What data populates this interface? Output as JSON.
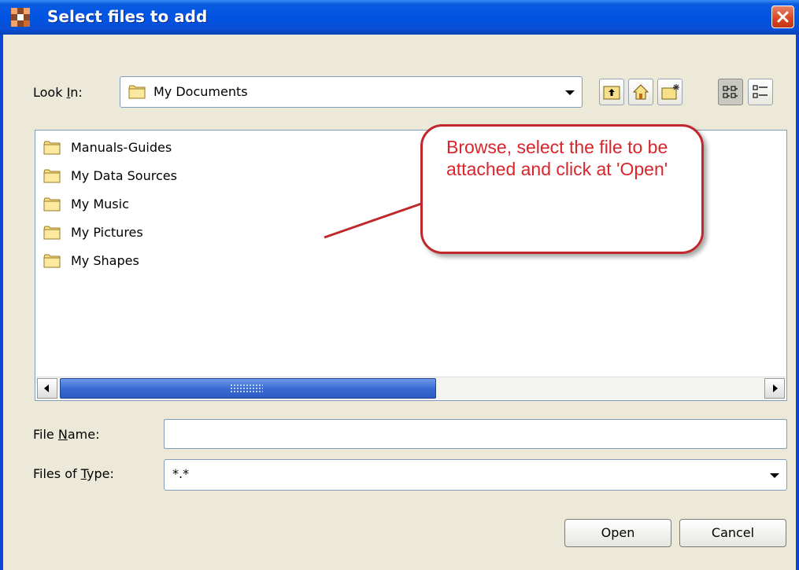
{
  "window": {
    "title": "Select files to add"
  },
  "look_in": {
    "label_pre": "Look ",
    "label_mnemonic": "I",
    "label_post": "n:",
    "value": "My Documents"
  },
  "files": [
    {
      "name": "Manuals-Guides"
    },
    {
      "name": "My Data Sources"
    },
    {
      "name": "My Music"
    },
    {
      "name": "My Pictures"
    },
    {
      "name": "My Shapes"
    }
  ],
  "file_name": {
    "label_pre": "File ",
    "label_mnemonic": "N",
    "label_post": "ame:",
    "value": ""
  },
  "file_type": {
    "label_pre": "Files of ",
    "label_mnemonic": "T",
    "label_post": "ype:",
    "value": "*.*"
  },
  "buttons": {
    "open": "Open",
    "cancel": "Cancel"
  },
  "callout": {
    "text": "Browse, select the file to be attached and click at 'Open'"
  },
  "icons": {
    "app": "app-icon",
    "close": "close-icon",
    "up": "up-folder-icon",
    "home": "home-icon",
    "new_folder": "new-folder-icon",
    "list": "list-view-icon",
    "details": "details-view-icon",
    "folder": "folder-icon",
    "dropdown": "chevron-down-icon"
  },
  "colors": {
    "titlebar": "#0054e3",
    "callout_border": "#c0282c",
    "callout_text": "#d8252b",
    "scroll_thumb": "#3a6bd4"
  }
}
